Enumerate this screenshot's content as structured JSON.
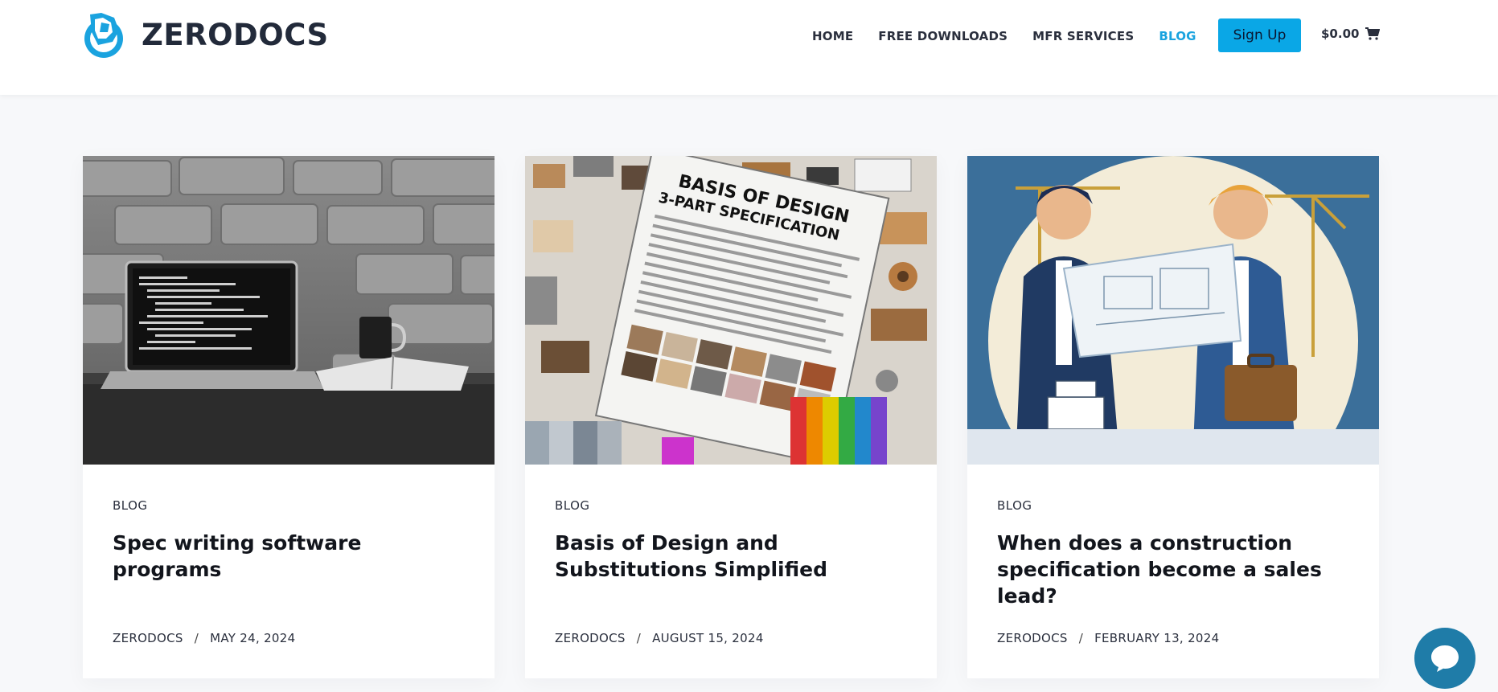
{
  "brand": {
    "name": "ZERODOCS"
  },
  "nav": {
    "items": [
      {
        "label": "HOME"
      },
      {
        "label": "FREE DOWNLOADS"
      },
      {
        "label": "MFR SERVICES"
      },
      {
        "label": "BLOG"
      }
    ],
    "active": "BLOG",
    "signup_label": "Sign Up",
    "cart_total": "$0.00"
  },
  "posts": [
    {
      "category": "BLOG",
      "title": "Spec writing software programs",
      "author": "ZERODOCS",
      "date": "MAY 24, 2024",
      "image": "laptop-on-desk-photo"
    },
    {
      "category": "BLOG",
      "title": "Basis of Design and Substitutions Simplified",
      "author": "ZERODOCS",
      "date": "AUGUST 15, 2024",
      "image": "spec-document-illustration",
      "image_text": "BASIS OF DESIGN 3-PART SPECIFICATION"
    },
    {
      "category": "BLOG",
      "title": "When does a construction specification become a sales lead?",
      "author": "ZERODOCS",
      "date": "FEBRUARY 13, 2024",
      "image": "two-businessmen-blueprint-illustration"
    }
  ],
  "colors": {
    "accent": "#1aa3df",
    "button": "#0aa7e6",
    "chat": "#1f7ca8"
  },
  "icons": {
    "cart": "cart-icon",
    "chat": "chat-bubble-icon",
    "logo": "logo-mark"
  }
}
